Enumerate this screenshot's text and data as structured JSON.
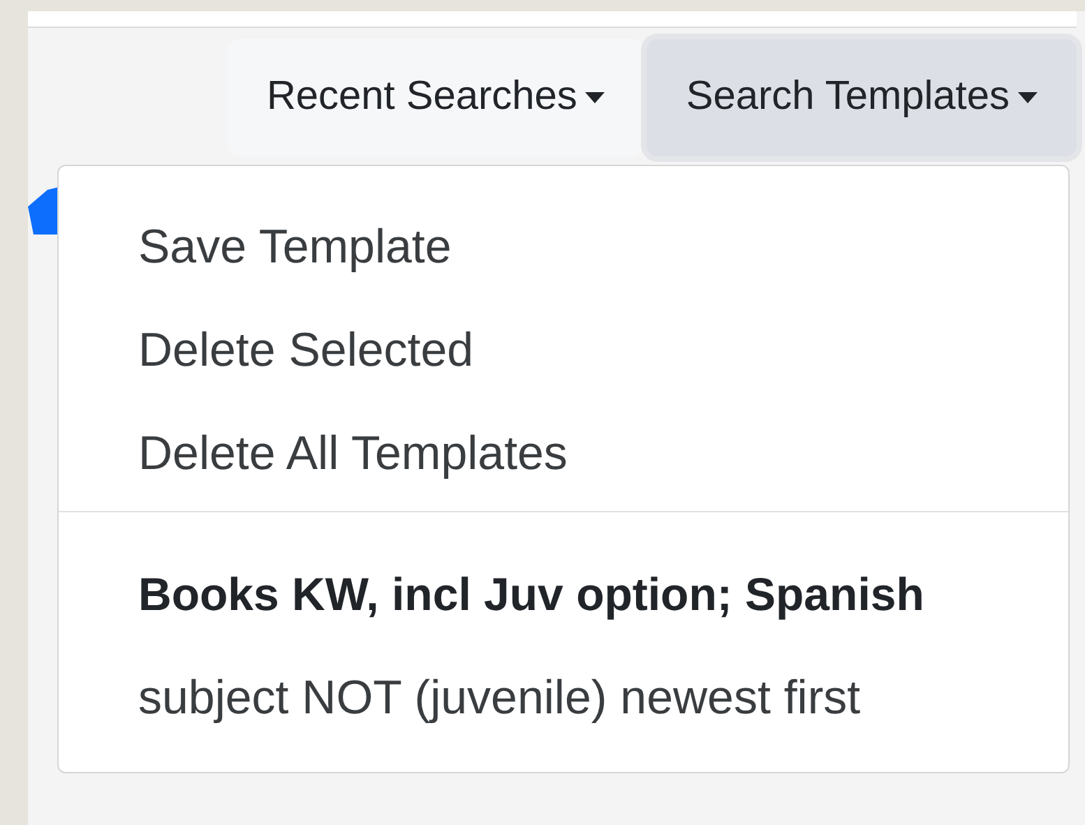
{
  "toolbar": {
    "buttons": [
      {
        "label": "Recent Searches",
        "selected": false
      },
      {
        "label": "Search Templates",
        "selected": true
      }
    ]
  },
  "dropdown": {
    "actions": [
      "Save Template",
      "Delete Selected",
      "Delete All Templates"
    ],
    "templates": [
      {
        "name": "Books KW, incl Juv option; Spanish",
        "description": "subject NOT (juvenile) newest first"
      }
    ]
  }
}
